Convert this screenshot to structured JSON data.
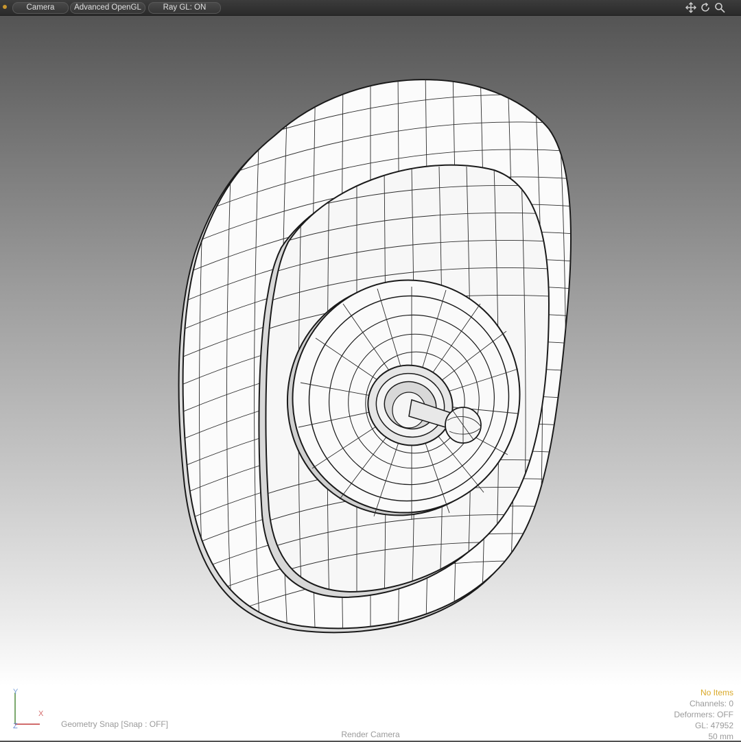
{
  "toolbar": {
    "camera_label": "Camera",
    "opengl_label": "Advanced OpenGL",
    "raygl_label": "Ray GL: ON",
    "accent_color": "#c8962e",
    "icons": [
      "move-view-icon",
      "rotate-view-icon",
      "zoom-view-icon"
    ]
  },
  "viewport": {
    "axes": {
      "y_label": "Y",
      "x_label": "X",
      "z_label": "Z"
    },
    "snap_status": "Geometry Snap  [Snap : OFF]",
    "render_camera": "Render Camera"
  },
  "info_panel": {
    "selection": "No Items",
    "channels": "Channels: 0",
    "deformers": "Deformers: OFF",
    "gl_count": "GL: 47952",
    "focal_length": "50 mm",
    "selection_color": "#d9a828"
  }
}
